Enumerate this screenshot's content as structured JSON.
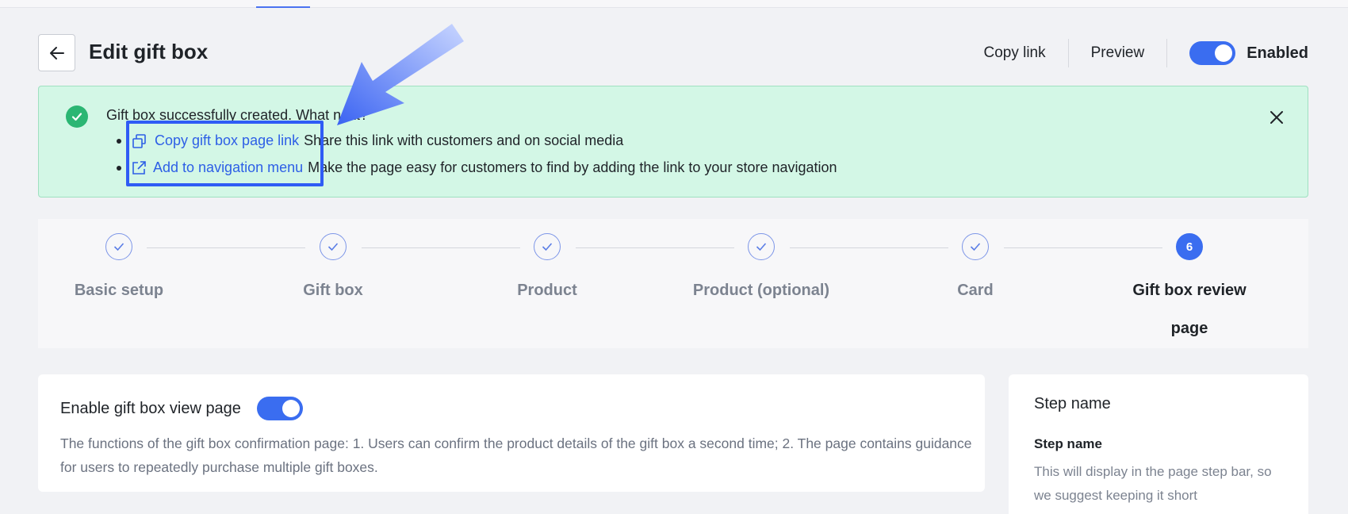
{
  "header": {
    "title": "Edit gift box",
    "copy_link": "Copy link",
    "preview": "Preview",
    "enabled_label": "Enabled",
    "enabled": true
  },
  "banner": {
    "headline": "Gift box successfully created. What next?",
    "items": [
      {
        "link": "Copy gift box page link",
        "text": "Share this link with customers and on social media",
        "icon": "copy-icon"
      },
      {
        "link": "Add to navigation menu",
        "text": "Make the page easy for customers to find by adding the link to your store navigation",
        "icon": "external-link-icon"
      }
    ]
  },
  "steps": [
    {
      "label": "Basic setup",
      "status": "done"
    },
    {
      "label": "Gift box",
      "status": "done"
    },
    {
      "label": "Product",
      "status": "done"
    },
    {
      "label": "Product (optional)",
      "status": "done"
    },
    {
      "label": "Card",
      "status": "done"
    },
    {
      "label": "Gift box review page",
      "status": "active",
      "number": "6"
    }
  ],
  "view_page": {
    "title": "Enable gift box view page",
    "enabled": true,
    "description": "The functions of the gift box confirmation page: 1. Users can confirm the product details of the gift box a second time; 2. The page contains guidance for users to repeatedly purchase multiple gift boxes."
  },
  "sidebar": {
    "title": "Step name",
    "field_label": "Step name",
    "help": "This will display in the page step bar, so we suggest keeping it short"
  },
  "colors": {
    "accent": "#3a6df0",
    "success_bg": "#d3f7e6",
    "success": "#2bb673",
    "highlight": "#2f5cf5"
  }
}
